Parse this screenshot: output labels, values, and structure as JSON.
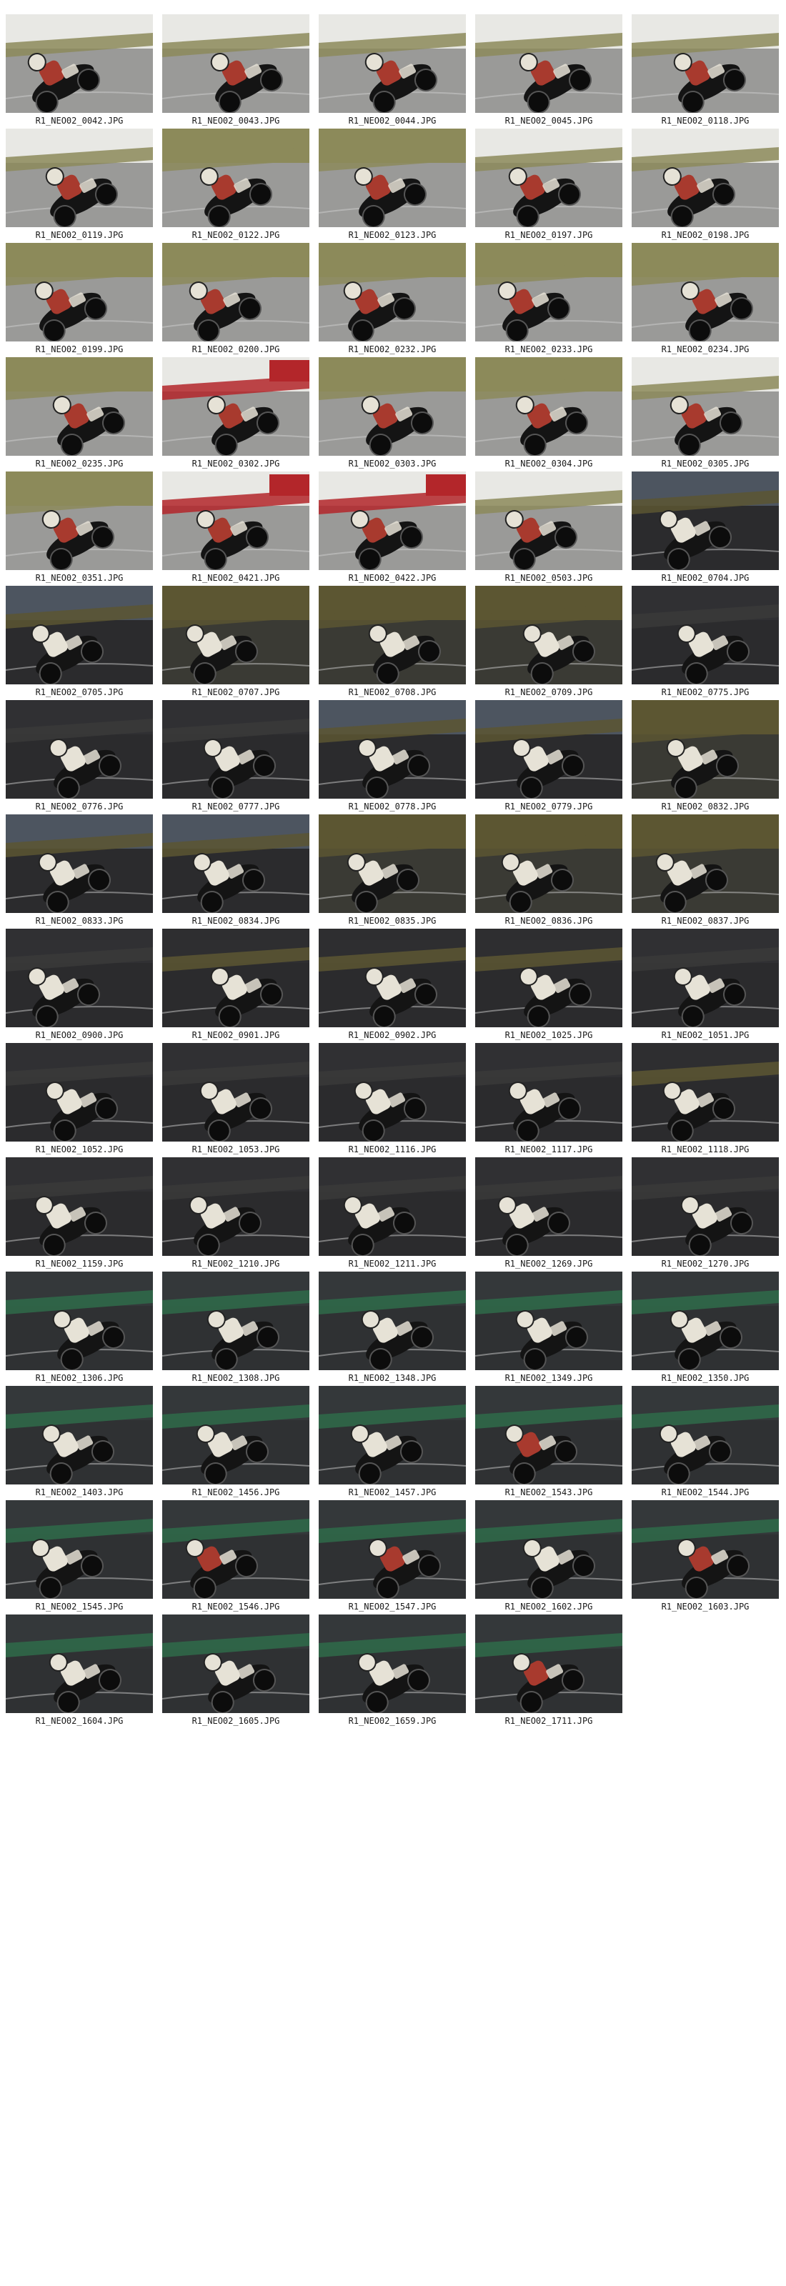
{
  "gallery": {
    "photos": [
      {
        "filename": "R1_NEO02_0042.JPG",
        "scene": "day-wall"
      },
      {
        "filename": "R1_NEO02_0043.JPG",
        "scene": "day-wall"
      },
      {
        "filename": "R1_NEO02_0044.JPG",
        "scene": "day-wall"
      },
      {
        "filename": "R1_NEO02_0045.JPG",
        "scene": "day-wall"
      },
      {
        "filename": "R1_NEO02_0118.JPG",
        "scene": "day-wall"
      },
      {
        "filename": "R1_NEO02_0119.JPG",
        "scene": "day-wall"
      },
      {
        "filename": "R1_NEO02_0122.JPG",
        "scene": "day-grass"
      },
      {
        "filename": "R1_NEO02_0123.JPG",
        "scene": "day-grass"
      },
      {
        "filename": "R1_NEO02_0197.JPG",
        "scene": "day-wall"
      },
      {
        "filename": "R1_NEO02_0198.JPG",
        "scene": "day-wall"
      },
      {
        "filename": "R1_NEO02_0199.JPG",
        "scene": "day-grass"
      },
      {
        "filename": "R1_NEO02_0200.JPG",
        "scene": "day-grass"
      },
      {
        "filename": "R1_NEO02_0232.JPG",
        "scene": "day-grass"
      },
      {
        "filename": "R1_NEO02_0233.JPG",
        "scene": "day-grass"
      },
      {
        "filename": "R1_NEO02_0234.JPG",
        "scene": "day-grass"
      },
      {
        "filename": "R1_NEO02_0235.JPG",
        "scene": "day-grass"
      },
      {
        "filename": "R1_NEO02_0302.JPG",
        "scene": "day-redwall"
      },
      {
        "filename": "R1_NEO02_0303.JPG",
        "scene": "day-grass"
      },
      {
        "filename": "R1_NEO02_0304.JPG",
        "scene": "day-grass"
      },
      {
        "filename": "R1_NEO02_0305.JPG",
        "scene": "day-wall"
      },
      {
        "filename": "R1_NEO02_0351.JPG",
        "scene": "day-grass"
      },
      {
        "filename": "R1_NEO02_0421.JPG",
        "scene": "day-redwall"
      },
      {
        "filename": "R1_NEO02_0422.JPG",
        "scene": "day-redwall"
      },
      {
        "filename": "R1_NEO02_0503.JPG",
        "scene": "day-wall"
      },
      {
        "filename": "R1_NEO02_0704.JPG",
        "scene": "dusk-barrier"
      },
      {
        "filename": "R1_NEO02_0705.JPG",
        "scene": "dusk-barrier"
      },
      {
        "filename": "R1_NEO02_0707.JPG",
        "scene": "dusk-grass"
      },
      {
        "filename": "R1_NEO02_0708.JPG",
        "scene": "dusk-grass"
      },
      {
        "filename": "R1_NEO02_0709.JPG",
        "scene": "dusk-grass"
      },
      {
        "filename": "R1_NEO02_0775.JPG",
        "scene": "dark-asphalt"
      },
      {
        "filename": "R1_NEO02_0776.JPG",
        "scene": "dark-asphalt"
      },
      {
        "filename": "R1_NEO02_0777.JPG",
        "scene": "dark-asphalt"
      },
      {
        "filename": "R1_NEO02_0778.JPG",
        "scene": "dusk-barrier"
      },
      {
        "filename": "R1_NEO02_0779.JPG",
        "scene": "dusk-barrier"
      },
      {
        "filename": "R1_NEO02_0832.JPG",
        "scene": "dusk-grass"
      },
      {
        "filename": "R1_NEO02_0833.JPG",
        "scene": "dusk-barrier"
      },
      {
        "filename": "R1_NEO02_0834.JPG",
        "scene": "dusk-barrier"
      },
      {
        "filename": "R1_NEO02_0835.JPG",
        "scene": "dusk-grass"
      },
      {
        "filename": "R1_NEO02_0836.JPG",
        "scene": "dusk-grass"
      },
      {
        "filename": "R1_NEO02_0837.JPG",
        "scene": "dusk-grass"
      },
      {
        "filename": "R1_NEO02_0900.JPG",
        "scene": "dark-asphalt"
      },
      {
        "filename": "R1_NEO02_0901.JPG",
        "scene": "dark-grass"
      },
      {
        "filename": "R1_NEO02_0902.JPG",
        "scene": "dark-grass"
      },
      {
        "filename": "R1_NEO02_1025.JPG",
        "scene": "dark-grass"
      },
      {
        "filename": "R1_NEO02_1051.JPG",
        "scene": "dark-asphalt"
      },
      {
        "filename": "R1_NEO02_1052.JPG",
        "scene": "dark-asphalt"
      },
      {
        "filename": "R1_NEO02_1053.JPG",
        "scene": "dark-asphalt"
      },
      {
        "filename": "R1_NEO02_1116.JPG",
        "scene": "dark-asphalt"
      },
      {
        "filename": "R1_NEO02_1117.JPG",
        "scene": "dark-asphalt"
      },
      {
        "filename": "R1_NEO02_1118.JPG",
        "scene": "dark-grass"
      },
      {
        "filename": "R1_NEO02_1159.JPG",
        "scene": "dark-asphalt"
      },
      {
        "filename": "R1_NEO02_1210.JPG",
        "scene": "dark-asphalt"
      },
      {
        "filename": "R1_NEO02_1211.JPG",
        "scene": "dark-asphalt"
      },
      {
        "filename": "R1_NEO02_1269.JPG",
        "scene": "dark-asphalt"
      },
      {
        "filename": "R1_NEO02_1270.JPG",
        "scene": "dark-asphalt"
      },
      {
        "filename": "R1_NEO02_1306.JPG",
        "scene": "green-stripe"
      },
      {
        "filename": "R1_NEO02_1308.JPG",
        "scene": "green-stripe"
      },
      {
        "filename": "R1_NEO02_1348.JPG",
        "scene": "green-stripe"
      },
      {
        "filename": "R1_NEO02_1349.JPG",
        "scene": "green-stripe"
      },
      {
        "filename": "R1_NEO02_1350.JPG",
        "scene": "green-stripe"
      },
      {
        "filename": "R1_NEO02_1403.JPG",
        "scene": "green-stripe"
      },
      {
        "filename": "R1_NEO02_1456.JPG",
        "scene": "green-stripe"
      },
      {
        "filename": "R1_NEO02_1457.JPG",
        "scene": "green-stripe"
      },
      {
        "filename": "R1_NEO02_1543.JPG",
        "scene": "green-stripe-red"
      },
      {
        "filename": "R1_NEO02_1544.JPG",
        "scene": "green-stripe"
      },
      {
        "filename": "R1_NEO02_1545.JPG",
        "scene": "green-stripe"
      },
      {
        "filename": "R1_NEO02_1546.JPG",
        "scene": "green-stripe-red"
      },
      {
        "filename": "R1_NEO02_1547.JPG",
        "scene": "green-stripe-red"
      },
      {
        "filename": "R1_NEO02_1602.JPG",
        "scene": "green-stripe"
      },
      {
        "filename": "R1_NEO02_1603.JPG",
        "scene": "green-stripe-red"
      },
      {
        "filename": "R1_NEO02_1604.JPG",
        "scene": "green-stripe"
      },
      {
        "filename": "R1_NEO02_1605.JPG",
        "scene": "green-stripe"
      },
      {
        "filename": "R1_NEO02_1659.JPG",
        "scene": "green-stripe"
      },
      {
        "filename": "R1_NEO02_1711.JPG",
        "scene": "green-stripe-red"
      }
    ]
  },
  "colors": {
    "page_background": "#ffffff",
    "caption_text": "#1a1a1a",
    "asphalt_day": "#9a9a98",
    "asphalt_dark": "#2b2b2d",
    "grass_day": "#8c8a5a",
    "grass_dusk": "#5c5632",
    "wall_white": "#e8e8e4",
    "wall_red": "#b3262a",
    "stripe_green": "#2f6b4a",
    "bike_black": "#141414",
    "rider_red": "#a83a2e",
    "rider_white": "#e6e2d6"
  }
}
